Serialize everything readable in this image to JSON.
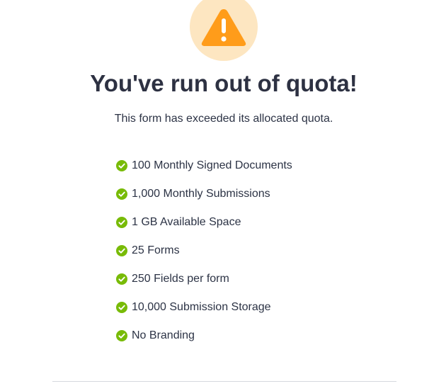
{
  "icon": {
    "name": "warning-triangle-icon",
    "accent": "#ff9c1a",
    "halo": "#fde6c1"
  },
  "title": "You've run out of quota!",
  "subtitle": "This form has exceeded its allocated quota.",
  "features": [
    {
      "label": "100 Monthly Signed Documents",
      "icon": "check-circle-icon"
    },
    {
      "label": "1,000 Monthly Submissions",
      "icon": "check-circle-icon"
    },
    {
      "label": "1 GB Available Space",
      "icon": "check-circle-icon"
    },
    {
      "label": "25 Forms",
      "icon": "check-circle-icon"
    },
    {
      "label": "250 Fields per form",
      "icon": "check-circle-icon"
    },
    {
      "label": "10,000 Submission Storage",
      "icon": "check-circle-icon"
    },
    {
      "label": "No Branding",
      "icon": "check-circle-icon"
    }
  ],
  "colors": {
    "check": "#78bb07",
    "text": "#2c3345",
    "divider": "#d6d8de"
  }
}
